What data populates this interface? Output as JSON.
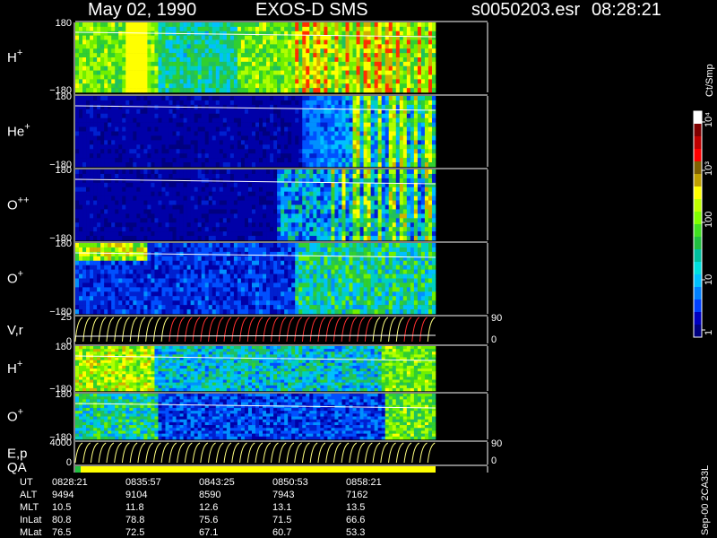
{
  "header": {
    "date": "May 02, 1990",
    "instrument": "EXOS-D SMS",
    "file": "s0050203.esr",
    "time": "08:28:21"
  },
  "colorbar": {
    "title": "Ct/Smp",
    "ticks": [
      "1",
      "10",
      "100",
      "10³",
      "10⁴"
    ],
    "colors": [
      "#000080",
      "#0000c0",
      "#0040ff",
      "#0080ff",
      "#00c0ff",
      "#00e0e0",
      "#00c0a0",
      "#20c040",
      "#40e020",
      "#80ff00",
      "#c0ff00",
      "#ffff00",
      "#c0a000",
      "#806000",
      "#ff0000",
      "#c00000",
      "#800000",
      "#ffffff"
    ]
  },
  "panels": [
    {
      "label": "H",
      "sup": "+",
      "top": "180",
      "bottom": "−180"
    },
    {
      "label": "He",
      "sup": "+",
      "top": "180",
      "bottom": "−180"
    },
    {
      "label": "O",
      "sup": "++",
      "top": "180",
      "bottom": "−180"
    },
    {
      "label": "O",
      "sup": "+",
      "top": "180",
      "bottom": "−180"
    },
    {
      "label": "V,r",
      "sup": "",
      "top": "25",
      "bottom": "0",
      "right_top": "90",
      "right_bottom": "0"
    },
    {
      "label": "H",
      "sup": "+",
      "top": "180",
      "bottom": "−180"
    },
    {
      "label": "O",
      "sup": "+",
      "top": "180",
      "bottom": "−180"
    },
    {
      "label": "E,p",
      "sup": "",
      "top": "4000",
      "bottom": "0",
      "right_top": "90",
      "right_bottom": "0"
    },
    {
      "label": "QA",
      "sup": "",
      "top": "",
      "bottom": ""
    }
  ],
  "footer_table": {
    "row_labels": [
      "UT",
      "ALT",
      "MLT",
      "InLat",
      "MLat"
    ],
    "columns": [
      [
        "0828:21",
        "9494",
        "10.5",
        "80.8",
        "76.5"
      ],
      [
        "0835:57",
        "9104",
        "11.8",
        "78.8",
        "72.5"
      ],
      [
        "0843:25",
        "8590",
        "12.6",
        "75.6",
        "67.1"
      ],
      [
        "0850:53",
        "7943",
        "13.1",
        "71.5",
        "60.7"
      ],
      [
        "0858:21",
        "7162",
        "13.5",
        "66.6",
        "53.3"
      ]
    ]
  },
  "side_note": "Sep-00 2CA33L",
  "chart_data": {
    "type": "heatmap",
    "title": "May 02, 1990   EXOS-D SMS",
    "x_ticks": [
      "0828:21",
      "0835:57",
      "0843:25",
      "0850:53",
      "0858:21"
    ],
    "panels": [
      "H+",
      "He+",
      "O++",
      "O+",
      "V,r",
      "H+",
      "O+",
      "E,p",
      "QA"
    ],
    "y_ranges": [
      [
        -180,
        180
      ],
      [
        -180,
        180
      ],
      [
        -180,
        180
      ],
      [
        -180,
        180
      ],
      [
        0,
        25
      ],
      [
        -180,
        180
      ],
      [
        -180,
        180
      ],
      [
        0,
        4000
      ],
      null
    ],
    "colorbar_label": "Ct/Smp",
    "colorbar_scale": "log",
    "colorbar_range": [
      1,
      10000
    ]
  }
}
